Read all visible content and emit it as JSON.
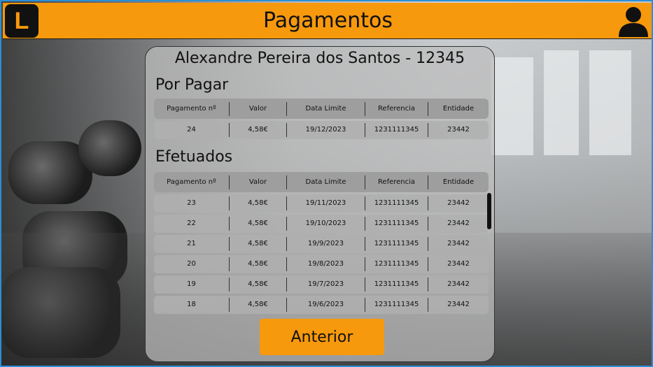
{
  "header": {
    "logo_letter": "L",
    "title": "Pagamentos",
    "user_icon": "user-icon"
  },
  "client": {
    "name": "Alexandre Pereira dos Santos - 12345"
  },
  "pending": {
    "title": "Por Pagar",
    "columns": [
      "Pagamento nº",
      "Valor",
      "Data Limite",
      "Referencia",
      "Entidade"
    ],
    "rows": [
      [
        "24",
        "4,58€",
        "19/12/2023",
        "1231111345",
        "23442"
      ]
    ]
  },
  "done": {
    "title": "Efetuados",
    "columns": [
      "Pagamento nº",
      "Valor",
      "Data Limite",
      "Referencia",
      "Entidade"
    ],
    "rows": [
      [
        "23",
        "4,58€",
        "19/11/2023",
        "1231111345",
        "23442"
      ],
      [
        "22",
        "4,58€",
        "19/10/2023",
        "1231111345",
        "23442"
      ],
      [
        "21",
        "4,58€",
        "19/9/2023",
        "1231111345",
        "23442"
      ],
      [
        "20",
        "4,58€",
        "19/8/2023",
        "1231111345",
        "23442"
      ],
      [
        "19",
        "4,58€",
        "19/7/2023",
        "1231111345",
        "23442"
      ],
      [
        "18",
        "4,58€",
        "19/6/2023",
        "1231111345",
        "23442"
      ]
    ]
  },
  "actions": {
    "previous_label": "Anterior"
  },
  "colors": {
    "accent": "#f7990d",
    "frame": "#2a8fd8"
  }
}
